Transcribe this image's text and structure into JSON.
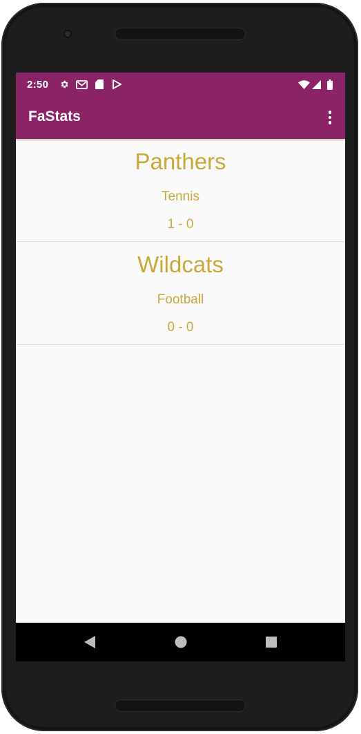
{
  "status_bar": {
    "time": "2:50",
    "icons_left": [
      "settings-icon",
      "gmail-icon",
      "sd-card-icon",
      "play-store-icon"
    ],
    "icons_right": [
      "wifi-icon",
      "signal-icon",
      "battery-icon"
    ]
  },
  "app_bar": {
    "title": "FaStats",
    "menu_icon": "more-vert-icon",
    "color": "#8a2467"
  },
  "teams": [
    {
      "name": "Panthers",
      "sport": "Tennis",
      "record": "1 - 0"
    },
    {
      "name": "Wildcats",
      "sport": "Football",
      "record": "0 - 0"
    }
  ],
  "text_color": "#c9a93a",
  "nav_bar": {
    "buttons": [
      "back-icon",
      "home-icon",
      "recents-icon"
    ]
  }
}
